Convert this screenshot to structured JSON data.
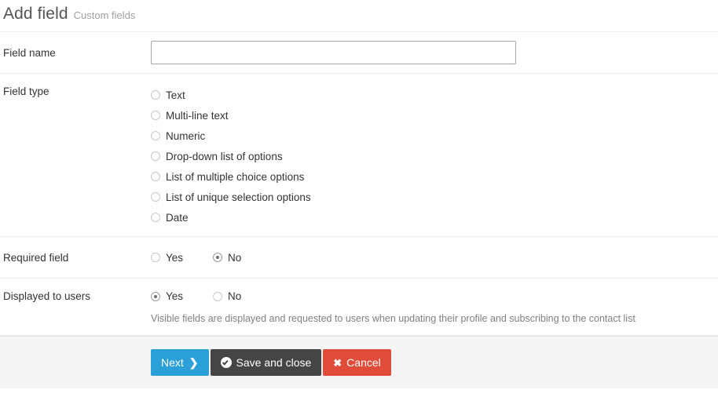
{
  "header": {
    "title": "Add field",
    "subtitle": "Custom fields"
  },
  "form": {
    "field_name": {
      "label": "Field name",
      "value": "",
      "placeholder": ""
    },
    "field_type": {
      "label": "Field type",
      "options": [
        {
          "label": "Text",
          "selected": false
        },
        {
          "label": "Multi-line text",
          "selected": false
        },
        {
          "label": "Numeric",
          "selected": false
        },
        {
          "label": "Drop-down list of options",
          "selected": false
        },
        {
          "label": "List of multiple choice options",
          "selected": false
        },
        {
          "label": "List of unique selection options",
          "selected": false
        },
        {
          "label": "Date",
          "selected": false
        }
      ]
    },
    "required_field": {
      "label": "Required field",
      "options": [
        {
          "label": "Yes",
          "selected": false
        },
        {
          "label": "No",
          "selected": true
        }
      ]
    },
    "displayed_to_users": {
      "label": "Displayed to users",
      "options": [
        {
          "label": "Yes",
          "selected": true
        },
        {
          "label": "No",
          "selected": false
        }
      ],
      "help_text": "Visible fields are displayed and requested to users when updating their profile and subscribing to the contact list"
    }
  },
  "footer": {
    "buttons": [
      {
        "label": "Next",
        "icon": "chevron-right-icon",
        "color": "#2b9fd8"
      },
      {
        "label": "Save and close",
        "icon": "check-circle-icon",
        "color": "#464545"
      },
      {
        "label": "Cancel",
        "icon": "times-icon",
        "color": "#e04b3a"
      }
    ]
  },
  "icons": {
    "chevron_right": "❯",
    "times": "✖"
  }
}
